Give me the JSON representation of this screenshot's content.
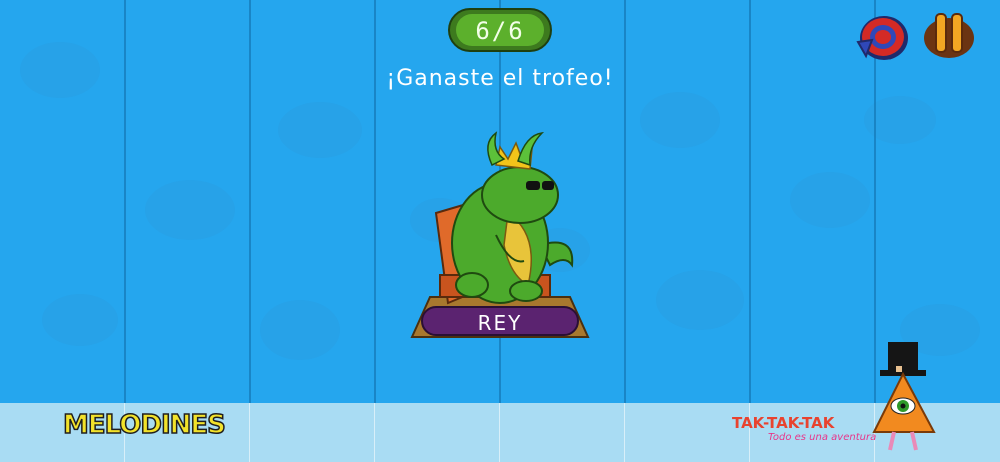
{
  "hud": {
    "score": "6/6",
    "message": "¡Ganaste el trofeo!",
    "restart_icon": "restart-icon",
    "pause_icon": "pause-icon"
  },
  "trophy": {
    "name": "REY"
  },
  "footer": {
    "brand_left": "MELODINES",
    "brand_right_title": "TAK-TAK-TAK",
    "brand_right_subtitle": "Todo es una aventura"
  },
  "colors": {
    "background": "#25a6ee",
    "footer": "#a9dcf3",
    "score_green": "#5cb02c",
    "label_purple": "#5b2370",
    "pedestal_brown": "#a8782e"
  }
}
